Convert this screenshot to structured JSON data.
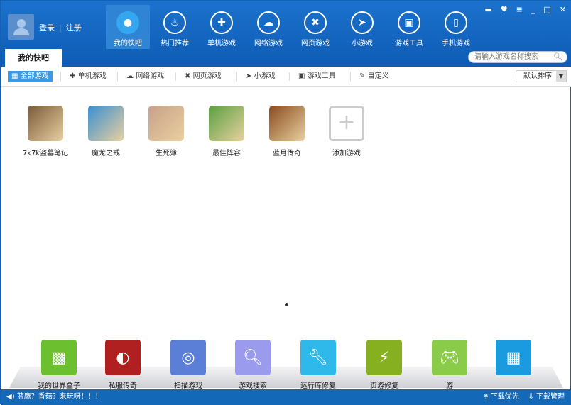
{
  "header": {
    "login": "登录",
    "register": "注册",
    "nav": [
      {
        "label": "我的快吧",
        "icon": "user-icon"
      },
      {
        "label": "热门推荐",
        "icon": "fire-icon"
      },
      {
        "label": "单机游戏",
        "icon": "gamepad-icon"
      },
      {
        "label": "网络游戏",
        "icon": "cloud-icon"
      },
      {
        "label": "网页游戏",
        "icon": "swords-icon"
      },
      {
        "label": "小游戏",
        "icon": "plane-icon"
      },
      {
        "label": "游戏工具",
        "icon": "toolbox-icon"
      },
      {
        "label": "手机游戏",
        "icon": "phone-icon"
      }
    ],
    "search_placeholder": "请输入游戏名称搜索"
  },
  "tab": "我的快吧",
  "filters": [
    "全部游戏",
    "单机游戏",
    "网络游戏",
    "网页游戏",
    "小游戏",
    "游戏工具",
    "自定义"
  ],
  "sort": "默认排序",
  "games": [
    {
      "label": "7k7k盗墓笔记",
      "color": "#7a5a3a"
    },
    {
      "label": "魔龙之戒",
      "color": "#3a8fd0"
    },
    {
      "label": "生死簿",
      "color": "#c9a08a"
    },
    {
      "label": "最佳阵容",
      "color": "#5aa040"
    },
    {
      "label": "蓝月传奇",
      "color": "#8a4a20"
    }
  ],
  "add_game": "添加游戏",
  "dock": [
    {
      "label": "我的世界盒子",
      "color": "#6cbf2e"
    },
    {
      "label": "私服传奇",
      "color": "#b02020"
    },
    {
      "label": "扫描游戏",
      "color": "#5b7fd6"
    },
    {
      "label": "游戏搜索",
      "color": "#9b9bee"
    },
    {
      "label": "运行库修复",
      "color": "#2fb8ea"
    },
    {
      "label": "页游修复",
      "color": "#86b020"
    },
    {
      "label": "游",
      "color": "#8acb4a"
    },
    {
      "label": "",
      "color": "#1a9be0"
    }
  ],
  "status": {
    "message": "蓝鹰？香菇？来玩呀！！！",
    "download_priority": "下载优先",
    "download_manager": "下载管理"
  }
}
